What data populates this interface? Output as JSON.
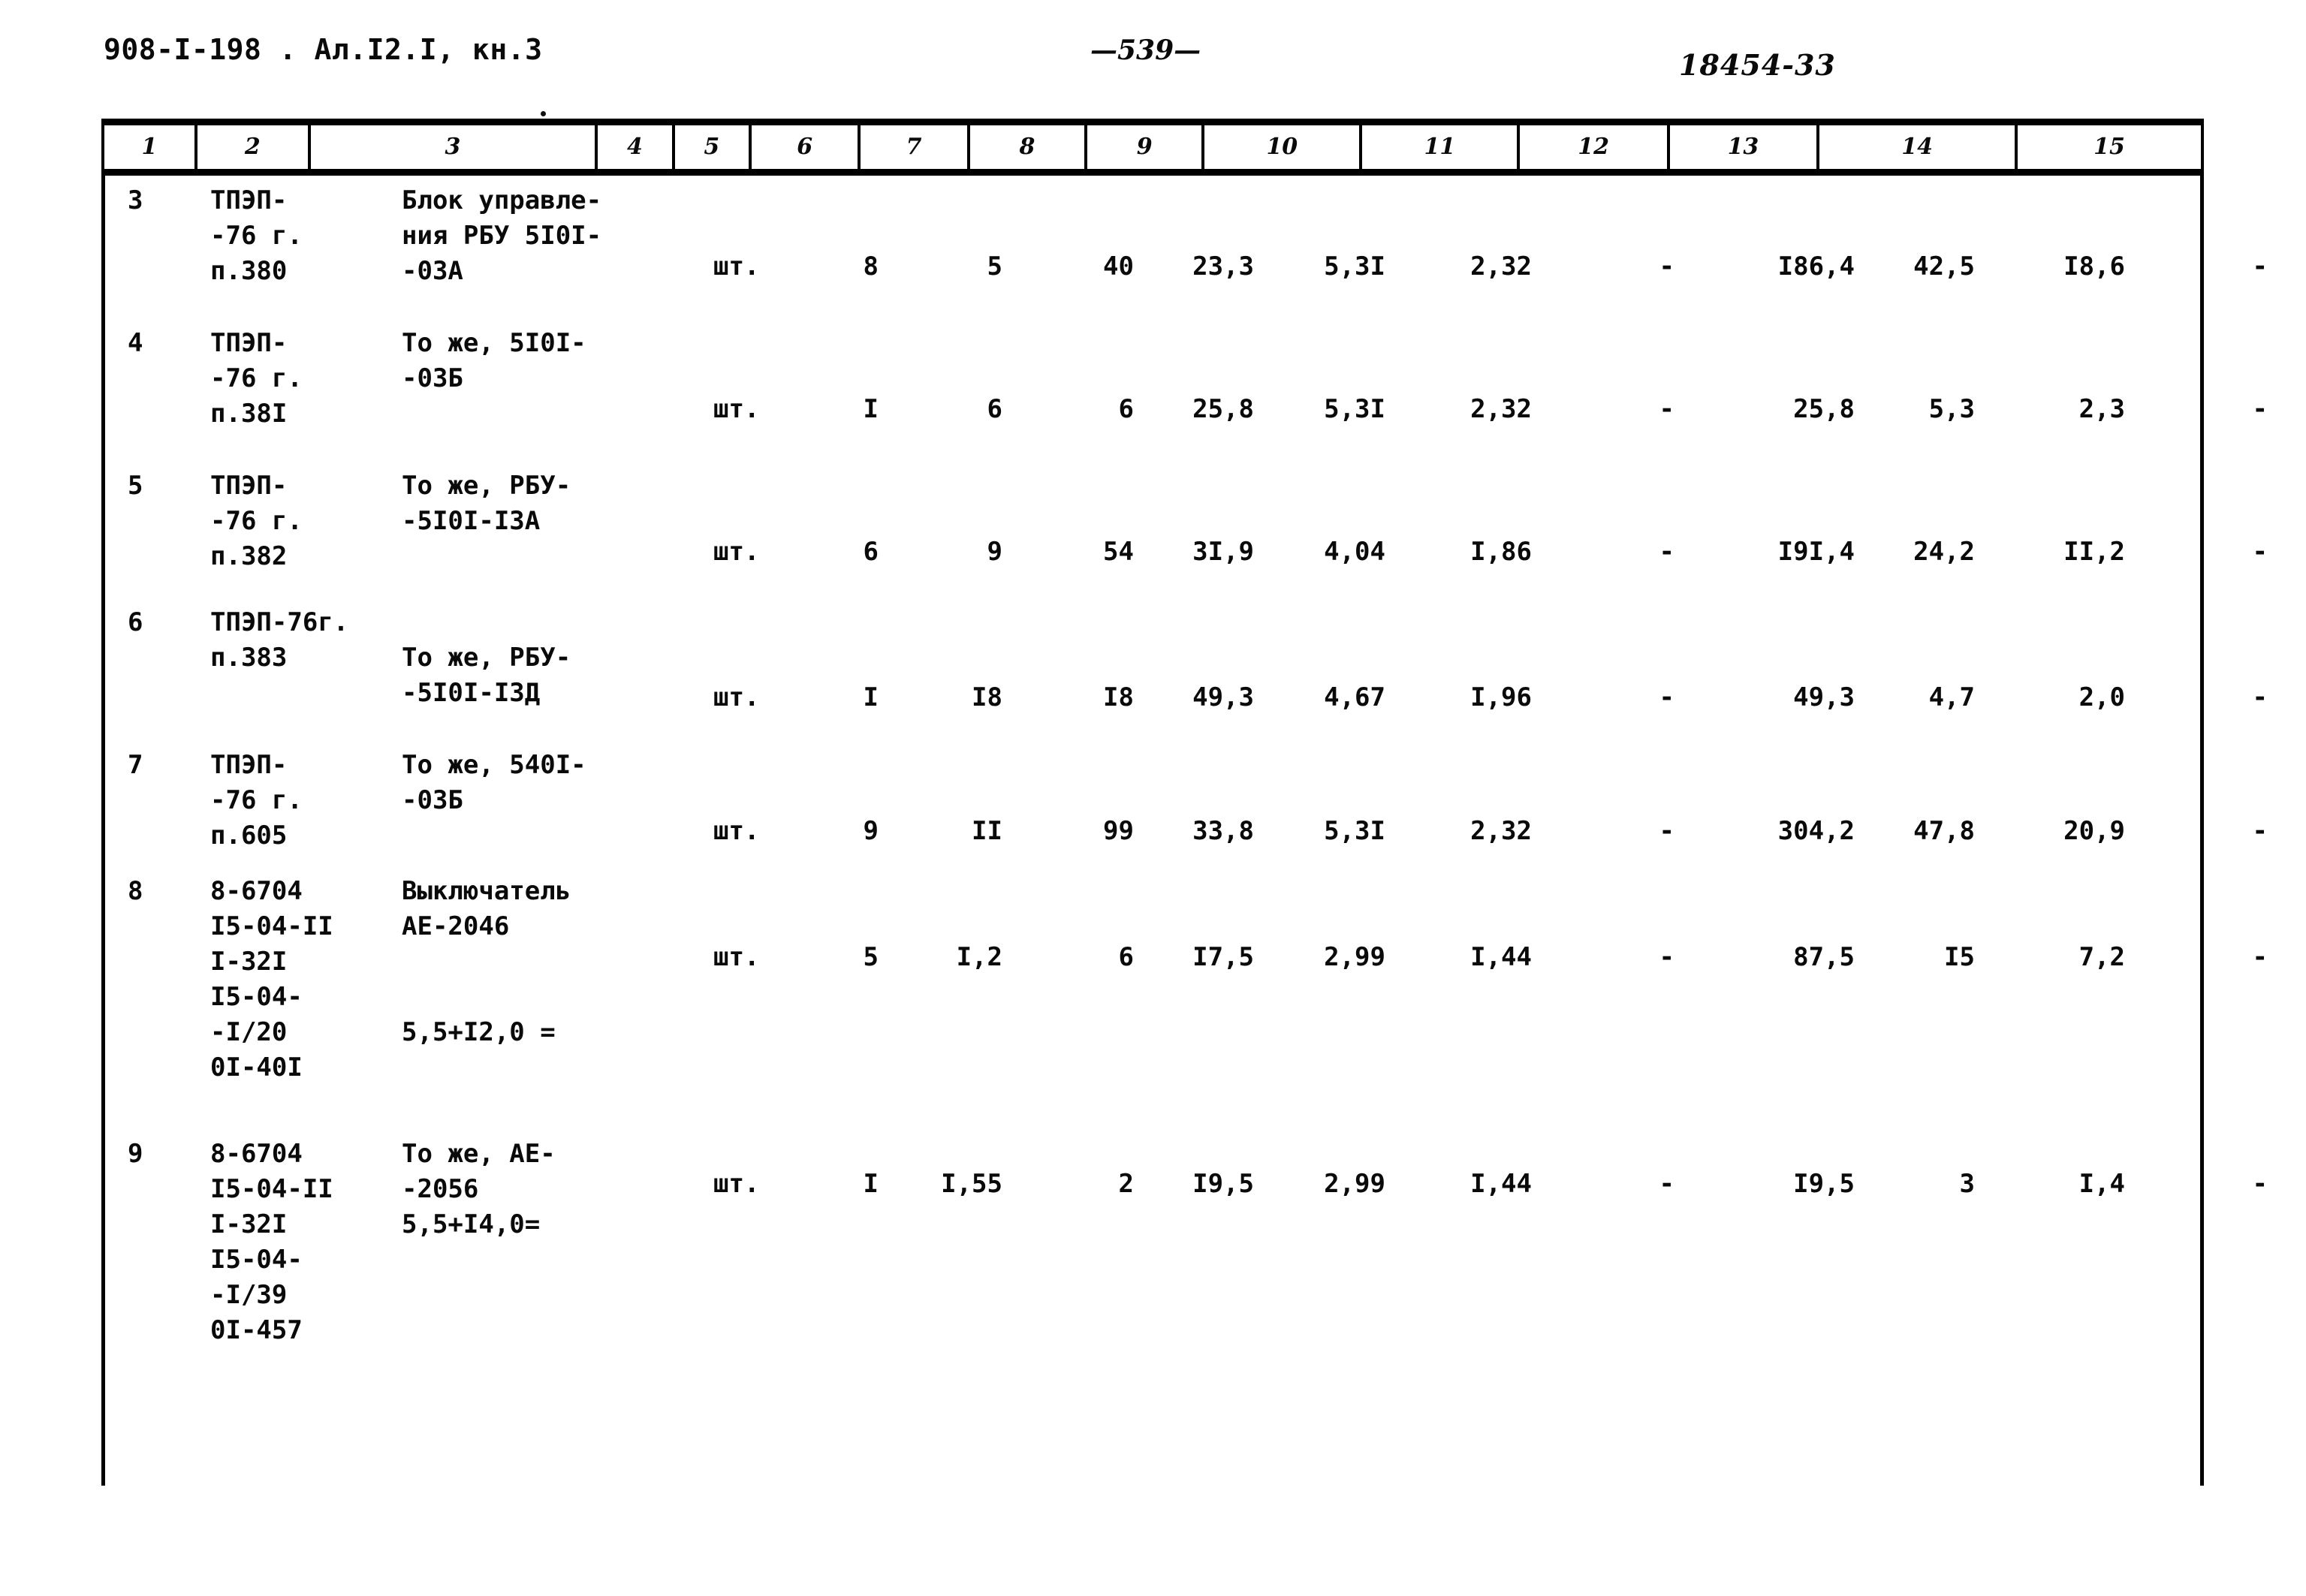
{
  "page": {
    "header_left": "908-I-198 . Ал.I2.I, кн.3",
    "header_center": "—539—",
    "header_right": "18454-33"
  },
  "table": {
    "column_numbers": [
      "1",
      "2",
      "3",
      "4",
      "5",
      "6",
      "7",
      "8",
      "9",
      "10",
      "11",
      "12",
      "13",
      "14",
      "15"
    ],
    "rows": [
      {
        "c1": "3",
        "c2": [
          "ТПЭП-",
          "-76 г.",
          "п.380"
        ],
        "c3": [
          "Блок управле-",
          "ния РБУ 5I0I-",
          "-03А"
        ],
        "c4": "шт.",
        "c5": "8",
        "c6": "5",
        "c7": "40",
        "c8": "23,3",
        "c9": "5,3I",
        "c10": "2,32",
        "c11": "-",
        "c12": "I86,4",
        "c13": "42,5",
        "c14": "I8,6",
        "c15": "-"
      },
      {
        "c1": "4",
        "c2": [
          "ТПЭП-",
          "-76 г.",
          "п.38I"
        ],
        "c3": [
          "То же, 5I0I-",
          "-03Б"
        ],
        "c4": "шт.",
        "c5": "I",
        "c6": "6",
        "c7": "6",
        "c8": "25,8",
        "c9": "5,3I",
        "c10": "2,32",
        "c11": "-",
        "c12": "25,8",
        "c13": "5,3",
        "c14": "2,3",
        "c15": "-"
      },
      {
        "c1": "5",
        "c2": [
          "ТПЭП-",
          "-76 г.",
          "п.382"
        ],
        "c3": [
          "То же, РБУ-",
          "-5I0I-I3А"
        ],
        "c4": "шт.",
        "c5": "6",
        "c6": "9",
        "c7": "54",
        "c8": "3I,9",
        "c9": "4,04",
        "c10": "I,86",
        "c11": "-",
        "c12": "I9I,4",
        "c13": "24,2",
        "c14": "II,2",
        "c15": "-"
      },
      {
        "c1": "6",
        "c2": [
          "ТПЭП-76г.",
          "п.383"
        ],
        "c3": [
          "То же, РБУ-",
          "-5I0I-I3Д"
        ],
        "c4": "шт.",
        "c5": "I",
        "c6": "I8",
        "c7": "I8",
        "c8": "49,3",
        "c9": "4,67",
        "c10": "I,96",
        "c11": "-",
        "c12": "49,3",
        "c13": "4,7",
        "c14": "2,0",
        "c15": "-"
      },
      {
        "c1": "7",
        "c2": [
          "ТПЭП-",
          "-76 г.",
          "п.605"
        ],
        "c3": [
          "То же, 540I-",
          "-03Б"
        ],
        "c4": "шт.",
        "c5": "9",
        "c6": "II",
        "c7": "99",
        "c8": "33,8",
        "c9": "5,3I",
        "c10": "2,32",
        "c11": "-",
        "c12": "304,2",
        "c13": "47,8",
        "c14": "20,9",
        "c15": "-"
      },
      {
        "c1": "8",
        "c2": [
          "8-6704",
          "I5-04-II",
          "I-32I",
          "I5-04-",
          "-I/20",
          "0I-40I"
        ],
        "c3": [
          "Выключатель",
          "АЕ-2046",
          "",
          "",
          "5,5+I2,0 ="
        ],
        "c4": "шт.",
        "c5": "5",
        "c6": "I,2",
        "c7": "6",
        "c8": "I7,5",
        "c9": "2,99",
        "c10": "I,44",
        "c11": "-",
        "c12": "87,5",
        "c13": "I5",
        "c14": "7,2",
        "c15": "-"
      },
      {
        "c1": "9",
        "c2": [
          "8-6704",
          "I5-04-II",
          "I-32I",
          "I5-04-",
          "-I/39",
          "0I-457"
        ],
        "c3": [
          "То же, АЕ-",
          "-2056",
          "5,5+I4,0="
        ],
        "c4": "шт.",
        "c5": "I",
        "c6": "I,55",
        "c7": "2",
        "c8": "I9,5",
        "c9": "2,99",
        "c10": "I,44",
        "c11": "-",
        "c12": "I9,5",
        "c13": "3",
        "c14": "I,4",
        "c15": "-"
      }
    ]
  }
}
